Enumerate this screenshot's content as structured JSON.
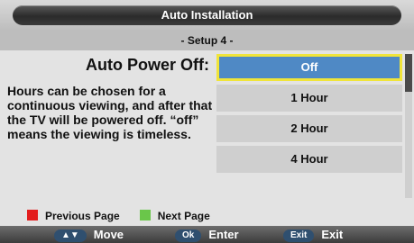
{
  "window": {
    "title": "Auto Installation",
    "subtitle": "- Setup 4 -"
  },
  "left": {
    "heading": "Auto Power Off:",
    "description": "Hours can be chosen for a continuous viewing, and after that the TV will be powered off. “off” means the viewing is timeless."
  },
  "options": [
    {
      "label": "Off",
      "selected": true
    },
    {
      "label": "1 Hour",
      "selected": false
    },
    {
      "label": "2 Hour",
      "selected": false
    },
    {
      "label": "4 Hour",
      "selected": false
    }
  ],
  "page_nav": {
    "previous": "Previous Page",
    "next": "Next Page"
  },
  "bottom": {
    "move_key": "▲▼",
    "move_label": "Move",
    "ok_key": "Ok",
    "ok_label": "Enter",
    "exit_key": "Exit",
    "exit_label": "Exit"
  },
  "colors": {
    "accent": "#4f89c5",
    "selection_border": "#f0e43a",
    "previous": "#e31d1d",
    "next": "#6ac64a"
  }
}
